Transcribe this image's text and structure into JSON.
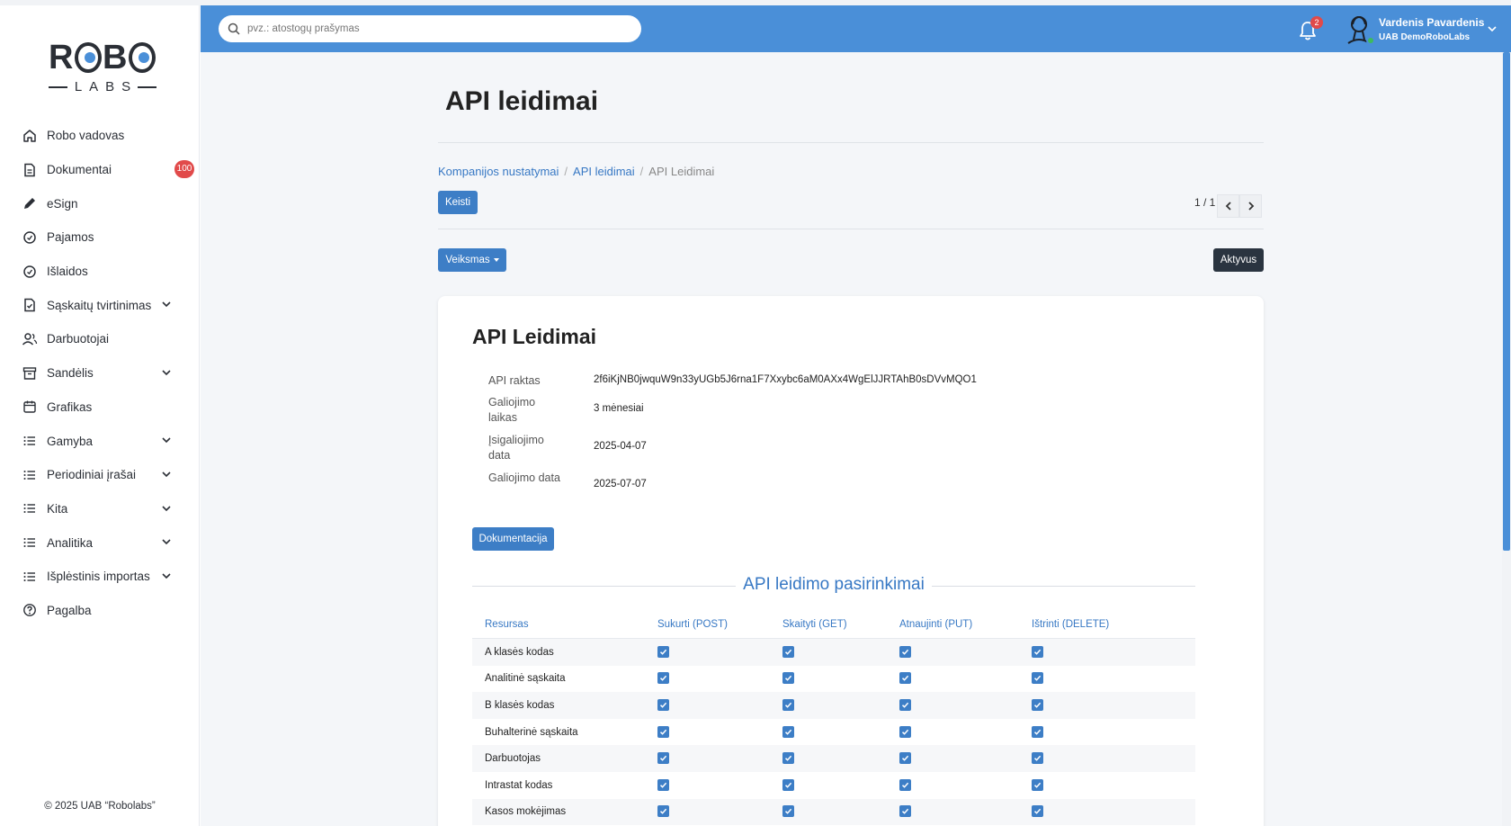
{
  "sidebar": {
    "logo": {
      "top": "ROBO",
      "bottom": "LABS"
    },
    "items": [
      {
        "label": "Robo vadovas",
        "icon": "home-icon",
        "chevron": false
      },
      {
        "label": "Dokumentai",
        "icon": "document-icon",
        "chevron": false,
        "badge": "100"
      },
      {
        "label": "eSign",
        "icon": "pen-icon",
        "chevron": false
      },
      {
        "label": "Pajamos",
        "icon": "income-icon",
        "chevron": false
      },
      {
        "label": "Išlaidos",
        "icon": "expense-icon",
        "chevron": false
      },
      {
        "label": "Sąskaitų tvirtinimas",
        "icon": "file-check-icon",
        "chevron": true
      },
      {
        "label": "Darbuotojai",
        "icon": "users-icon",
        "chevron": false
      },
      {
        "label": "Sandėlis",
        "icon": "archive-icon",
        "chevron": true
      },
      {
        "label": "Grafikas",
        "icon": "calendar-icon",
        "chevron": false
      },
      {
        "label": "Gamyba",
        "icon": "list-icon",
        "chevron": true
      },
      {
        "label": "Periodiniai įrašai",
        "icon": "list-icon",
        "chevron": true
      },
      {
        "label": "Kita",
        "icon": "list-icon",
        "chevron": true
      },
      {
        "label": "Analitika",
        "icon": "list-icon",
        "chevron": true
      },
      {
        "label": "Išplėstinis importas",
        "icon": "list-icon",
        "chevron": true
      },
      {
        "label": "Pagalba",
        "icon": "help-icon",
        "chevron": false
      }
    ],
    "copyright": "© 2025 UAB “Robolabs”"
  },
  "topbar": {
    "search_placeholder": "pvz.: atostogų prašymas",
    "notifications_count": "2",
    "user_name": "Vardenis Pavardenis",
    "user_company": "UAB DemoRoboLabs",
    "accent_color": "#4a8fd8"
  },
  "main": {
    "title": "API leidimai",
    "breadcrumb": [
      "Kompanijos nustatymai",
      "API leidimai",
      "API Leidimai"
    ],
    "edit_button": "Keisti",
    "pager": "1 / 1",
    "action_button": "Veiksmas",
    "status_badge": "Aktyvus",
    "card": {
      "title": "API Leidimai",
      "fields": [
        {
          "label": "API raktas",
          "value": "2f6iKjNB0jwquW9n33yUGb5J6rna1F7Xxybc6aM0AXx4WgElJJRTAhB0sDVvMQO1"
        },
        {
          "label": "Galiojimo laikas",
          "value": "3 mėnesiai"
        },
        {
          "label": "Įsigaliojimo data",
          "value": "2025-04-07"
        },
        {
          "label": "Galiojimo data",
          "value": "2025-07-07"
        }
      ],
      "doc_button": "Dokumentacija",
      "section_title": "API leidimo pasirinkimai",
      "table": {
        "headers": [
          "Resursas",
          "Sukurti (POST)",
          "Skaityti (GET)",
          "Atnaujinti (PUT)",
          "Ištrinti (DELETE)"
        ],
        "rows": [
          {
            "name": "A klasės kodas",
            "post": true,
            "get": true,
            "put": true,
            "delete": true
          },
          {
            "name": "Analitinė sąskaita",
            "post": true,
            "get": true,
            "put": true,
            "delete": true
          },
          {
            "name": "B klasės kodas",
            "post": true,
            "get": true,
            "put": true,
            "delete": true
          },
          {
            "name": "Buhalterinė sąskaita",
            "post": true,
            "get": true,
            "put": true,
            "delete": true
          },
          {
            "name": "Darbuotojas",
            "post": true,
            "get": true,
            "put": true,
            "delete": true
          },
          {
            "name": "Intrastat kodas",
            "post": true,
            "get": true,
            "put": true,
            "delete": true
          },
          {
            "name": "Kasos mokėjimas",
            "post": true,
            "get": true,
            "put": true,
            "delete": true
          }
        ]
      }
    }
  }
}
